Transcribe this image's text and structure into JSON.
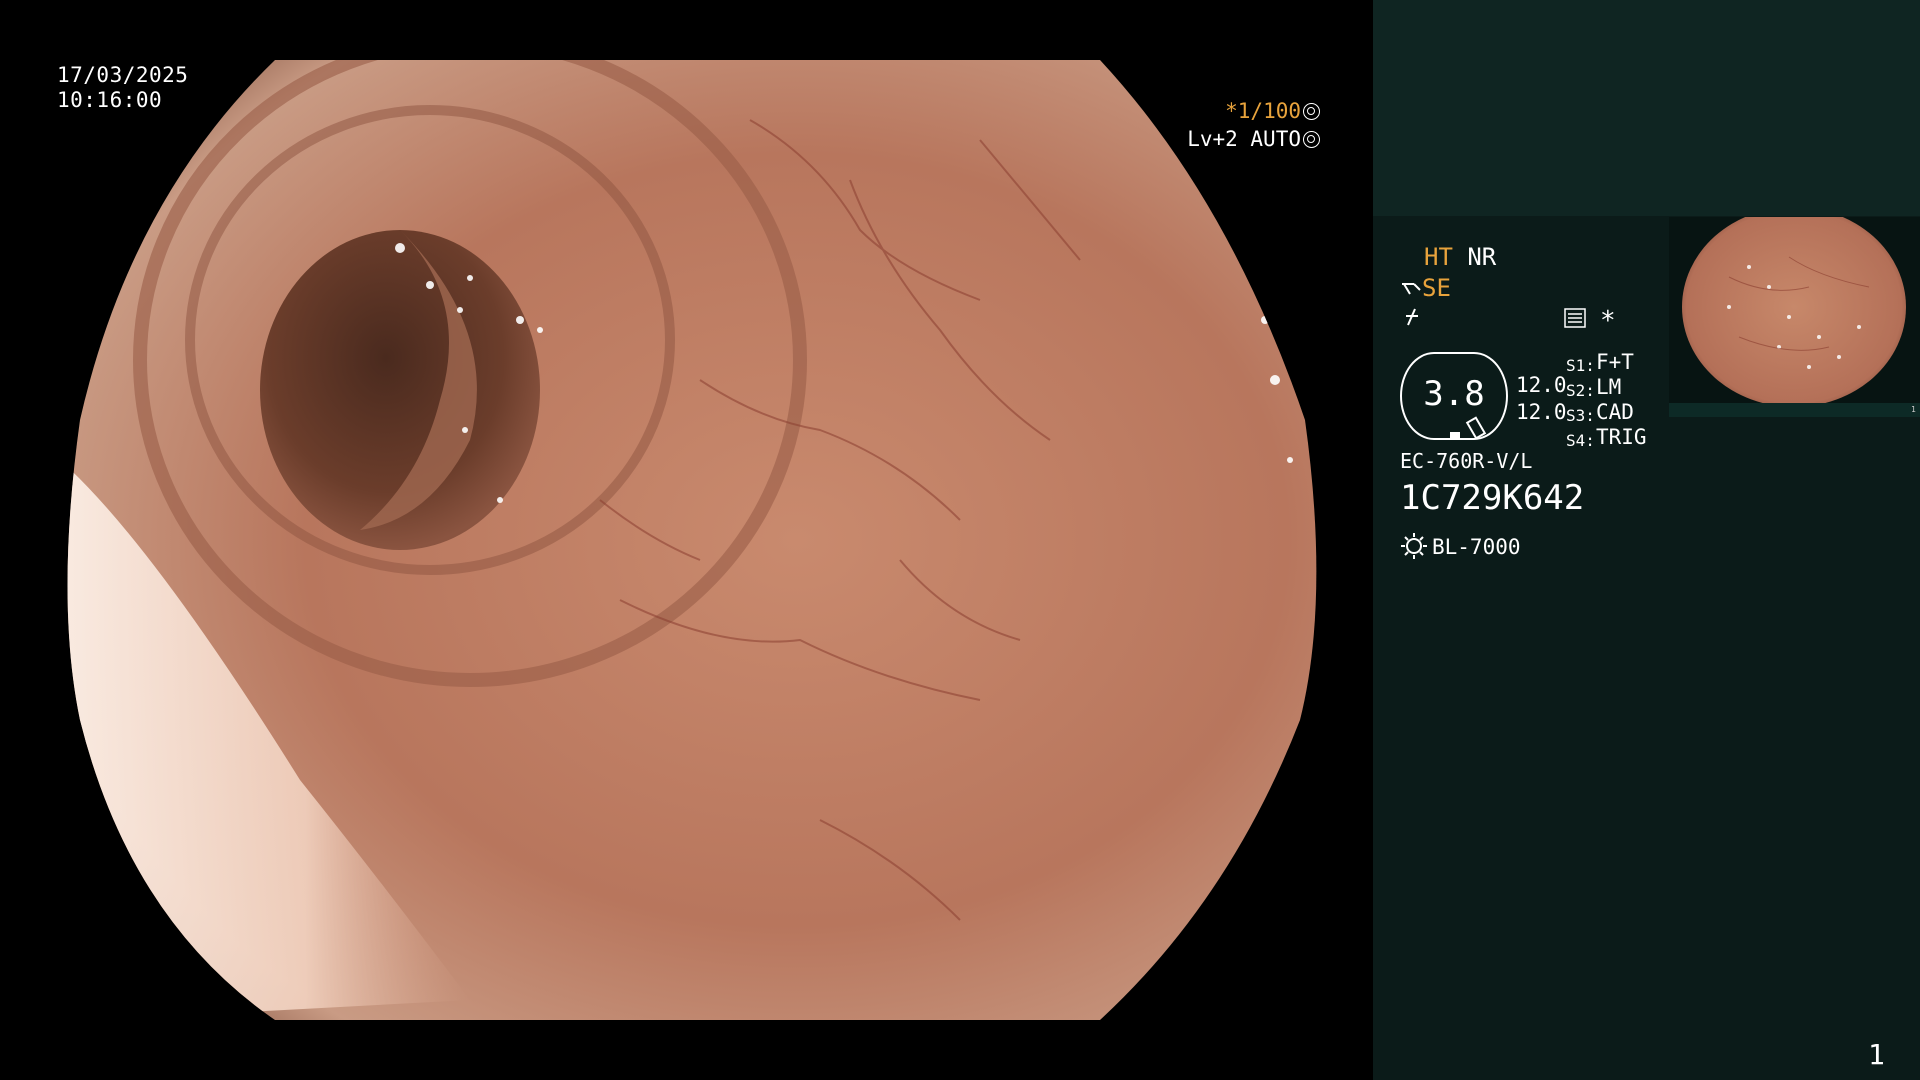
{
  "overlay": {
    "date": "17/03/2025",
    "time": "10:16:00",
    "shutter_prefix": "*",
    "shutter": "1/100",
    "level": "Lv+2 AUTO"
  },
  "panel": {
    "ht": "HT",
    "nr": "NR",
    "se": "SE",
    "star": "*",
    "gauge_value": "3.8",
    "values": [
      "12.0",
      "12.0"
    ],
    "switches": [
      {
        "label": "S1:",
        "value": "F+T"
      },
      {
        "label": "S2:",
        "value": "LM"
      },
      {
        "label": "S3:",
        "value": "CAD"
      },
      {
        "label": "S4:",
        "value": "TRIG"
      }
    ],
    "scope_model": "EC-760R-V/L",
    "scope_serial": "1C729K642",
    "light_source": "BL-7000",
    "page_number": "1"
  },
  "thumbnail": {
    "bar_left": "",
    "bar_right": "1"
  },
  "colors": {
    "accent": "#e8a33c",
    "panel_bg": "#0b1b19",
    "panel_top_bg": "#0f2522"
  },
  "icons": [
    "shutter-wheel-icon",
    "auto-iris-icon",
    "scope-tip-icon",
    "structure-icon",
    "lightning-icon",
    "menu-card-icon",
    "light-source-icon"
  ]
}
